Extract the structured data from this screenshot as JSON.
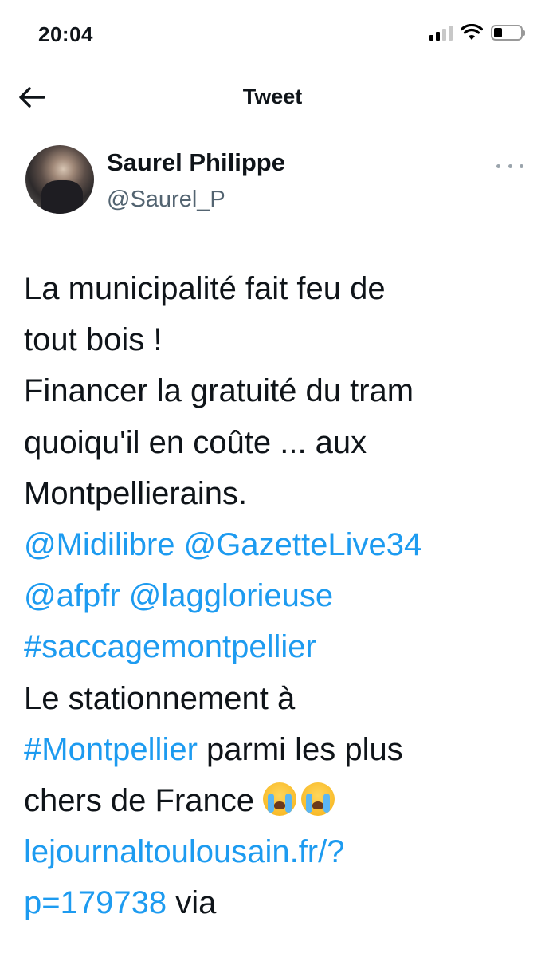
{
  "status_bar": {
    "time": "20:04"
  },
  "nav": {
    "title": "Tweet",
    "back_icon": "arrow-left-icon"
  },
  "author": {
    "name": "Saurel Philippe",
    "handle": "@Saurel_P",
    "more_icon": "more-dots-icon"
  },
  "tweet": {
    "text_1": "La municipalité fait feu de",
    "text_2": "tout bois !",
    "text_3": "Financer la gratuité du tram",
    "text_4": "quoiqu'il en coûte ... aux",
    "text_5": "Montpellierains.",
    "mention_midilibre": "@Midilibre",
    "mention_gazette": "@GazetteLive34",
    "mention_afpfr": "@afpfr",
    "mention_laglorieuse": "@lagglorieuse",
    "hashtag_saccage": "#saccagemontpellier",
    "text_6": "Le stationnement à",
    "hashtag_montpellier": "#Montpellier",
    "text_7": " parmi les plus",
    "text_8": "chers de France",
    "emoji_name": "loudly-crying-face-emoji",
    "link_part1": "lejournaltoulousain.fr/?",
    "link_part2": "p=179738",
    "text_9": " via"
  }
}
